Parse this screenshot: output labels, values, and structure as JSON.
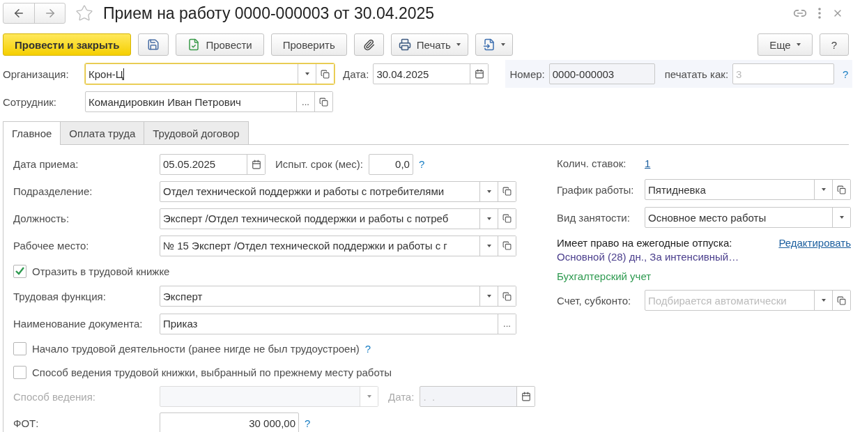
{
  "window": {
    "title": "Прием на работу 0000-000003 от 30.04.2025",
    "favorite": false
  },
  "toolbar": {
    "left": [
      {
        "kind": "primary",
        "label": "Провести и закрыть"
      },
      {
        "kind": "save"
      },
      {
        "kind": "post",
        "label": "Провести"
      },
      {
        "kind": "plain",
        "label": "Проверить"
      },
      {
        "kind": "attach"
      },
      {
        "kind": "print",
        "label": "Печать"
      },
      {
        "kind": "related"
      }
    ],
    "right": [
      {
        "kind": "menu",
        "label": "Еще"
      },
      {
        "kind": "plain",
        "label": "?"
      }
    ]
  },
  "header": {
    "organization": {
      "label": "Организация:",
      "value": "Крон-Ц",
      "focused": true
    },
    "date": {
      "label": "Дата:",
      "value": "30.04.2025"
    },
    "number": {
      "label": "Номер:",
      "value": "0000-000003"
    },
    "print_as": {
      "label": "печатать как:",
      "placeholder": "3",
      "help": "?"
    },
    "employee": {
      "label": "Сотрудник:",
      "value": "Командировкин Иван Петрович",
      "choice_button": "..."
    }
  },
  "tabs": [
    {
      "label": "Главное",
      "selected": true
    },
    {
      "label": "Оплата труда",
      "selected": false
    },
    {
      "label": "Трудовой договор",
      "selected": false
    }
  ],
  "left": [
    {
      "kind": "date_probation",
      "label": "Дата приема:",
      "value": "05.05.2025",
      "probation_label": "Испыт. срок (мес):",
      "probation_value": "0,0",
      "help": "?"
    },
    {
      "kind": "combo",
      "label": "Подразделение:",
      "value": "Отдел технической поддержки и работы с потребителями"
    },
    {
      "kind": "combo",
      "label": "Должность:",
      "value": "Эксперт /Отдел технической поддержки и работы с потреб"
    },
    {
      "kind": "combo",
      "label": "Рабочее место:",
      "value": "№ 15 Эксперт /Отдел технической поддержки и работы с г"
    },
    {
      "kind": "checkbox",
      "label": "Отразить в трудовой книжке",
      "checked": true
    },
    {
      "kind": "combo",
      "label": "Трудовая функция:",
      "value": "Эксперт"
    },
    {
      "kind": "choice",
      "label": "Наименование документа:",
      "value": "Приказ",
      "choice_button": "..."
    },
    {
      "kind": "checkbox",
      "label": "Начало трудовой деятельности (ранее нигде не был трудоустроен)",
      "checked": false,
      "help": "?"
    },
    {
      "kind": "checkbox",
      "label": "Способ ведения трудовой книжки, выбранный по прежнему месту работы",
      "checked": false
    },
    {
      "kind": "select_date",
      "label": "Способ ведения:",
      "disabled": true,
      "date_label": "Дата:",
      "date_value": ".  ."
    },
    {
      "kind": "amount",
      "label": "ФОТ:",
      "value": "30 000,00",
      "help": "?"
    }
  ],
  "right": [
    {
      "kind": "link_value",
      "label": "Колич. ставок:",
      "value": "1"
    },
    {
      "kind": "combo",
      "label": "График работы:",
      "value": "Пятидневка",
      "open_button": true
    },
    {
      "kind": "combo",
      "label": "Вид занятости:",
      "value": "Основное место работы",
      "open_button": false
    },
    {
      "kind": "vacation",
      "label": "Имеет право на ежегодные отпуска:",
      "link": "Редактировать",
      "value": "Основной (28) дн., За интенсивный…"
    },
    {
      "kind": "section",
      "label": "Бухгалтерский учет"
    },
    {
      "kind": "combo",
      "label": "Счет, субконто:",
      "placeholder": "Подбирается автоматически",
      "open_button": true
    }
  ]
}
